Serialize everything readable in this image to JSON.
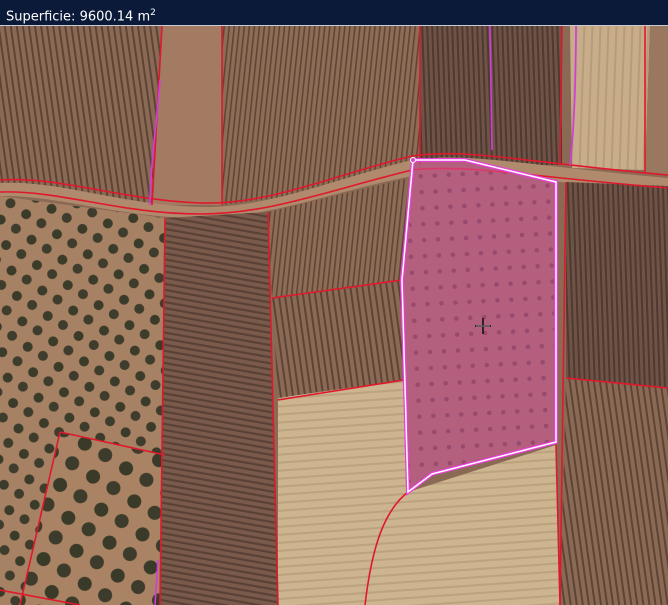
{
  "measurement": {
    "label": "Superficie:",
    "value": "9600.14",
    "unit": "m",
    "unit_exponent": "2"
  },
  "colors": {
    "parcel_border": "#e0182c",
    "selection_fill": "#d6579f",
    "selection_border": "#ffffff",
    "selection_outline": "#e63fd6",
    "header_bg": "#0c1a3a"
  },
  "map": {
    "type": "satellite-imagery",
    "cursor_icon": "crosshair-move-icon"
  }
}
